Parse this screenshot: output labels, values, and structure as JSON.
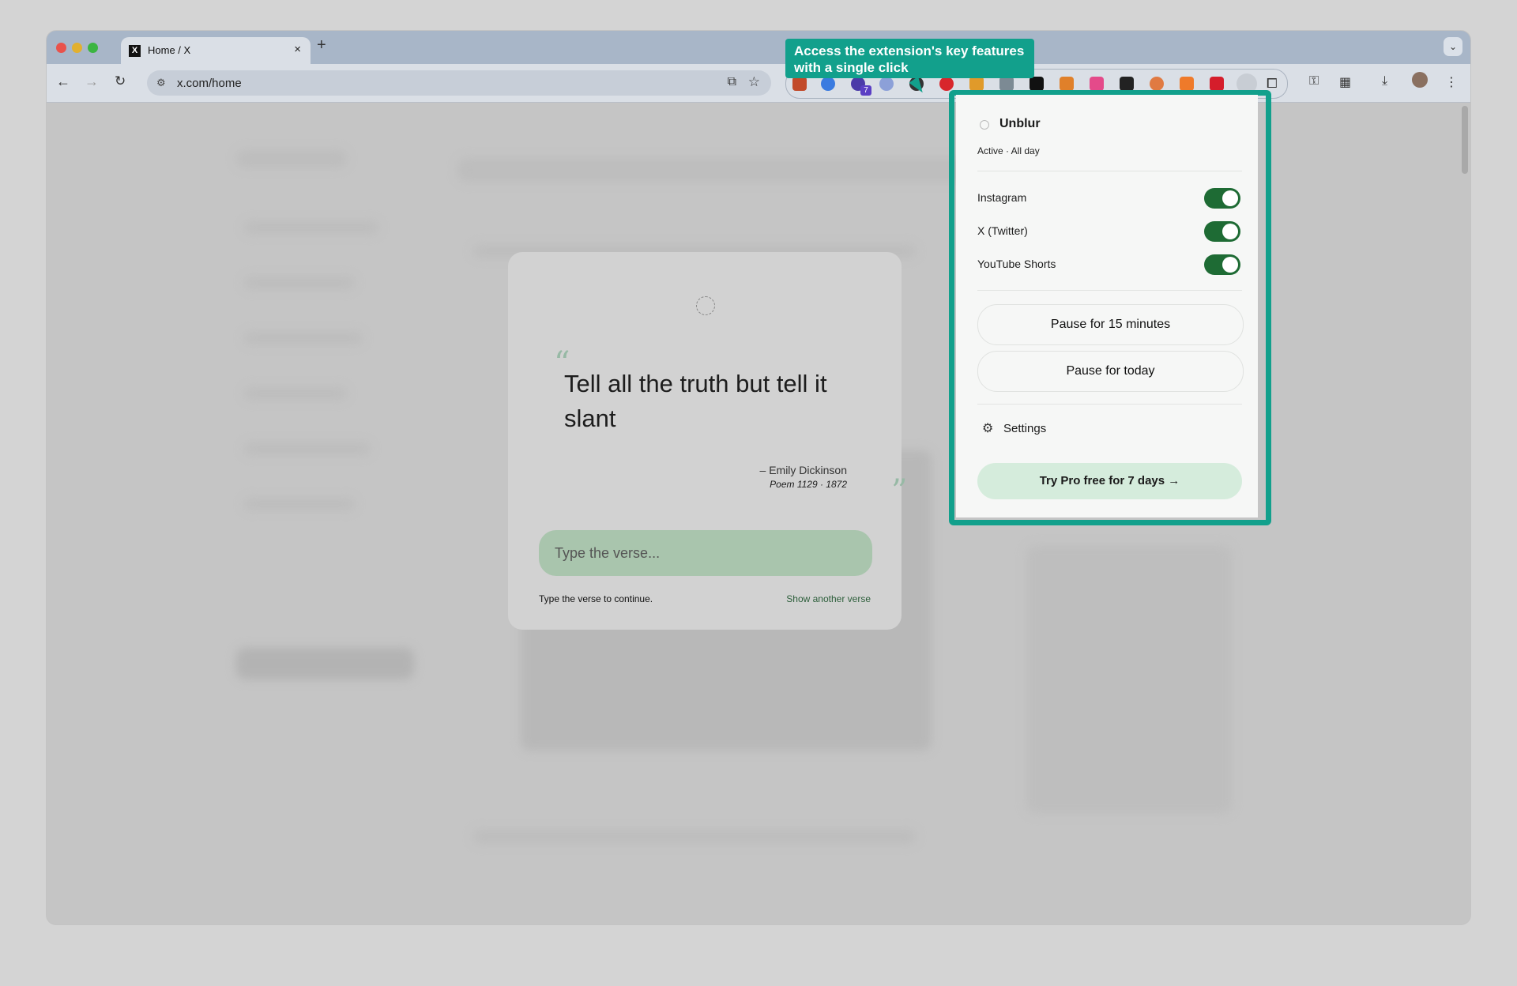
{
  "browser": {
    "tab_title": "Home / X",
    "tab_close": "×",
    "new_tab": "+",
    "url": "x.com/home",
    "ext_badge": "7"
  },
  "callout": {
    "text": "Access the extension's key features with a single click"
  },
  "verse_card": {
    "quote": "Tell all the truth but tell it slant",
    "attribution": "– Emily Dickinson",
    "citation": "Poem 1129 · 1872",
    "open_quote": "“",
    "close_quote": "”",
    "input_placeholder": "Type the verse...",
    "hint": "Type the verse to continue.",
    "another_link": "Show another verse"
  },
  "panel": {
    "title": "Unblur",
    "status": "Active · All day",
    "sites": [
      {
        "label": "Instagram",
        "on": true
      },
      {
        "label": "X (Twitter)",
        "on": true
      },
      {
        "label": "YouTube Shorts",
        "on": true
      }
    ],
    "pause_15": "Pause for 15 minutes",
    "pause_today": "Pause for today",
    "settings": "Settings",
    "pro_button": "Try Pro free for 7 days →"
  },
  "colors": {
    "accent": "#12a08c",
    "toggle_on": "#1e6b34",
    "pro_bg": "#d5ecdc"
  }
}
